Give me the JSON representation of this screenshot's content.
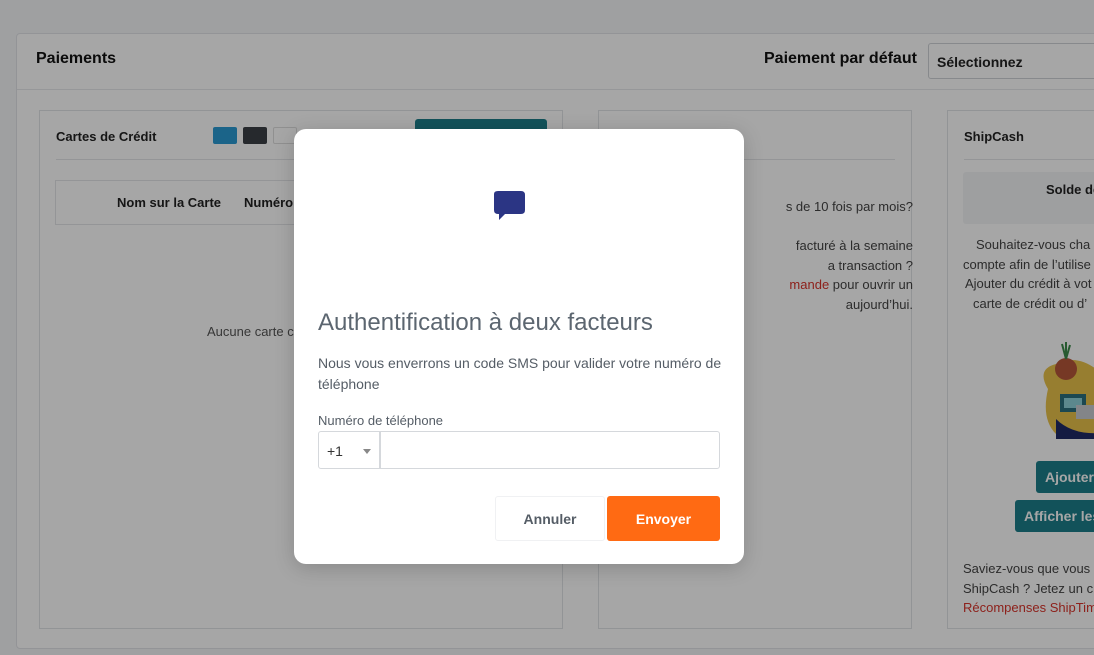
{
  "header": {
    "title": "Paiements",
    "default_payment_label": "Paiement par défaut",
    "default_payment_select": "Sélectionnez"
  },
  "credit_cards": {
    "title": "Cartes de Crédit",
    "logos": [
      "amex",
      "discover",
      "jcb"
    ],
    "columns": [
      "Nom sur la Carte",
      "Numéro"
    ],
    "empty_text": "Aucune carte c"
  },
  "middle_panel": {
    "question": "s de 10 fois par mois?",
    "line1": "facturé à la semaine",
    "line2": "a transaction ?",
    "line3_link": "mande",
    "line3_rest": " pour ouvrir un",
    "line4": "aujourd’hui."
  },
  "shipcash": {
    "title": "ShipCash",
    "balance_label": "Solde de",
    "balance_amount": "$",
    "text1": "Souhaitez-vous cha",
    "text2": "compte afin de l’utilise",
    "text3": "Ajouter du crédit à vot",
    "text4": "carte de crédit ou d’",
    "add_button": "Ajouter",
    "view_button": "Afficher les",
    "footer1": "Saviez-vous que vous",
    "footer2": "ShipCash ? Jetez un c",
    "footer_link": "Récompenses ShipTim"
  },
  "modal": {
    "icon": "chat-bubble-icon",
    "title": "Authentification à deux facteurs",
    "description": "Nous vous enverrons un code SMS pour valider votre numéro de téléphone",
    "phone_label": "Numéro de téléphone",
    "country_code": "+1",
    "phone_value": "",
    "cancel_label": "Annuler",
    "send_label": "Envoyer"
  },
  "colors": {
    "accent_orange": "#ff6a13",
    "teal": "#1d7f8a",
    "icon_navy": "#2b3584",
    "link_red": "#d9342b"
  }
}
